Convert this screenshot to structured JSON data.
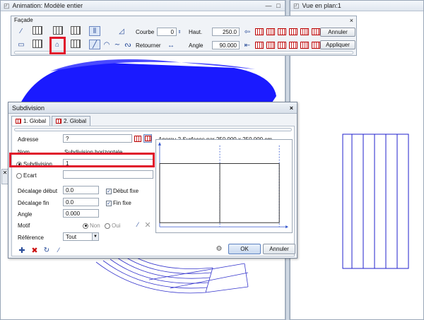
{
  "left_window": {
    "title": "Animation: Modèle entier",
    "min": "—",
    "max": "□"
  },
  "right_window": {
    "title": "Vue en plan:1"
  },
  "facade": {
    "title": "Façade",
    "close": "×",
    "courbe_label": "Courbe",
    "courbe_value": "0",
    "haut_label": "Haut.",
    "haut_value": "250.0",
    "retourner_label": "Retourner",
    "angle_label": "Angle",
    "angle_value": "90.000",
    "annuler": "Annuler",
    "appliquer": "Appliquer"
  },
  "dialog": {
    "title": "Subdivision",
    "close": "×",
    "tabs": [
      "1. Global",
      "2. Global"
    ],
    "adresse_label": "Adresse",
    "adresse_value": "?",
    "preview_caption": "Aperçu 2 Surfaces par 250.000 x 250.000 cm",
    "nom_label": "Nom",
    "nom_value": "Subdivision horizontale",
    "subdivision_label": "Subdivision",
    "subdivision_value": "1",
    "ecart_label": "Ecart",
    "decalage_debut_label": "Décalage début",
    "decalage_debut_value": "0.0",
    "debut_fixe_label": "Début fixe",
    "decalage_fin_label": "Décalage fin",
    "decalage_fin_value": "0.0",
    "fin_fixe_label": "Fin fixe",
    "angle_label": "Angle",
    "angle_value": "0.000",
    "motif_label": "Motif",
    "motif_non": "Non",
    "motif_oui": "Oui",
    "reference_label": "Référence",
    "reference_value": "Tout",
    "ok": "OK",
    "annuler": "Annuler"
  },
  "colors": {
    "accent_red": "#e0152b",
    "model_blue": "#1a1aff",
    "plan_blue": "#2222cc"
  },
  "icons": [
    "pipette-icon",
    "facade-grid-icon",
    "door-icon",
    "arrow-left-icon",
    "red-grid-icon",
    "delete-icon",
    "rotate-icon",
    "settings-icon"
  ]
}
